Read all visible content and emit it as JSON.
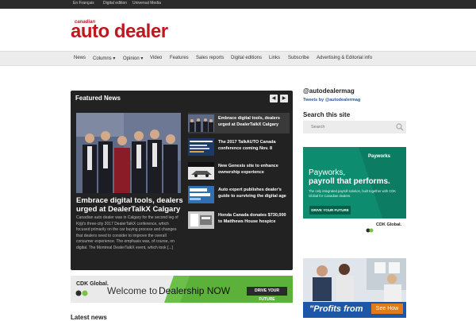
{
  "topbar": {
    "links": [
      "En Français",
      "Digital edition",
      "Universal Media"
    ]
  },
  "logo": {
    "small": "canadian",
    "big": "auto dealer"
  },
  "nav": {
    "items": [
      "News",
      "Columns",
      "Opinion",
      "Video",
      "Features",
      "Sales reports",
      "Digital editions",
      "Links",
      "Subscribe",
      "Advertising & Editorial info"
    ]
  },
  "featured": {
    "title": "Featured News",
    "hero": {
      "title": "Embrace digital tools, dealers urged at DealerTalkX Calgary",
      "text": "Canadian auto dealer was in Calgary for the second leg of Kijiji's three-city 2017 DealerTalkX conference, which focused primarily on the car buying process and changes that dealers need to consider to improve the overall consumer experience. The emphasis was, of course, on digital. The Montreal DealerTalkX event, which took [...]"
    },
    "items": [
      {
        "label": "Embrace digital tools, dealers urged at DealerTalkX Calgary"
      },
      {
        "label": "The 2017 TalkAUTO Canada conference coming Nov. 8"
      },
      {
        "label": "New Genesis site to enhance ownership experience"
      },
      {
        "label": "Auto expert publishes dealer's guide to surviving the digital age"
      },
      {
        "label": "Honda Canada donates $730,000 to Matthews House hospice"
      }
    ]
  },
  "banner": {
    "brand": "CDK Global.",
    "welcome": "Welcome to",
    "dealership": "Dealership NOW",
    "cta": "DRIVE YOUR FUTURE"
  },
  "latest": {
    "title": "Latest news"
  },
  "sidebar": {
    "handle": "@autodealermag",
    "tweets": "Tweets by @autodealermag",
    "search_title": "Search this site",
    "search_placeholder": "Search",
    "ad1": {
      "brand": "Payworks",
      "headline1": "Payworks,",
      "headline2": "payroll that performs.",
      "sub": "The only integrated payroll solution, built together with CDK Global for Canadian dealers.",
      "cta": "DRIVE YOUR FUTURE",
      "partner": "CDK Global."
    },
    "ad2": {
      "headline": "\"Profits from",
      "cta": "See How"
    }
  },
  "colors": {
    "brand": "#c0181e",
    "accent_green": "#0e8c6f",
    "link_blue": "#2a5a9a"
  }
}
